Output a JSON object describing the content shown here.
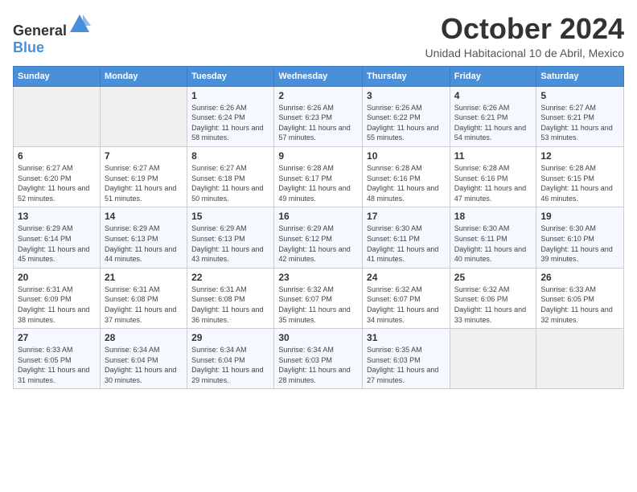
{
  "header": {
    "logo_general": "General",
    "logo_blue": "Blue",
    "month": "October 2024",
    "location": "Unidad Habitacional 10 de Abril, Mexico"
  },
  "days_of_week": [
    "Sunday",
    "Monday",
    "Tuesday",
    "Wednesday",
    "Thursday",
    "Friday",
    "Saturday"
  ],
  "weeks": [
    [
      {
        "day": "",
        "info": ""
      },
      {
        "day": "",
        "info": ""
      },
      {
        "day": "1",
        "info": "Sunrise: 6:26 AM\nSunset: 6:24 PM\nDaylight: 11 hours and 58 minutes."
      },
      {
        "day": "2",
        "info": "Sunrise: 6:26 AM\nSunset: 6:23 PM\nDaylight: 11 hours and 57 minutes."
      },
      {
        "day": "3",
        "info": "Sunrise: 6:26 AM\nSunset: 6:22 PM\nDaylight: 11 hours and 55 minutes."
      },
      {
        "day": "4",
        "info": "Sunrise: 6:26 AM\nSunset: 6:21 PM\nDaylight: 11 hours and 54 minutes."
      },
      {
        "day": "5",
        "info": "Sunrise: 6:27 AM\nSunset: 6:21 PM\nDaylight: 11 hours and 53 minutes."
      }
    ],
    [
      {
        "day": "6",
        "info": "Sunrise: 6:27 AM\nSunset: 6:20 PM\nDaylight: 11 hours and 52 minutes."
      },
      {
        "day": "7",
        "info": "Sunrise: 6:27 AM\nSunset: 6:19 PM\nDaylight: 11 hours and 51 minutes."
      },
      {
        "day": "8",
        "info": "Sunrise: 6:27 AM\nSunset: 6:18 PM\nDaylight: 11 hours and 50 minutes."
      },
      {
        "day": "9",
        "info": "Sunrise: 6:28 AM\nSunset: 6:17 PM\nDaylight: 11 hours and 49 minutes."
      },
      {
        "day": "10",
        "info": "Sunrise: 6:28 AM\nSunset: 6:16 PM\nDaylight: 11 hours and 48 minutes."
      },
      {
        "day": "11",
        "info": "Sunrise: 6:28 AM\nSunset: 6:16 PM\nDaylight: 11 hours and 47 minutes."
      },
      {
        "day": "12",
        "info": "Sunrise: 6:28 AM\nSunset: 6:15 PM\nDaylight: 11 hours and 46 minutes."
      }
    ],
    [
      {
        "day": "13",
        "info": "Sunrise: 6:29 AM\nSunset: 6:14 PM\nDaylight: 11 hours and 45 minutes."
      },
      {
        "day": "14",
        "info": "Sunrise: 6:29 AM\nSunset: 6:13 PM\nDaylight: 11 hours and 44 minutes."
      },
      {
        "day": "15",
        "info": "Sunrise: 6:29 AM\nSunset: 6:13 PM\nDaylight: 11 hours and 43 minutes."
      },
      {
        "day": "16",
        "info": "Sunrise: 6:29 AM\nSunset: 6:12 PM\nDaylight: 11 hours and 42 minutes."
      },
      {
        "day": "17",
        "info": "Sunrise: 6:30 AM\nSunset: 6:11 PM\nDaylight: 11 hours and 41 minutes."
      },
      {
        "day": "18",
        "info": "Sunrise: 6:30 AM\nSunset: 6:11 PM\nDaylight: 11 hours and 40 minutes."
      },
      {
        "day": "19",
        "info": "Sunrise: 6:30 AM\nSunset: 6:10 PM\nDaylight: 11 hours and 39 minutes."
      }
    ],
    [
      {
        "day": "20",
        "info": "Sunrise: 6:31 AM\nSunset: 6:09 PM\nDaylight: 11 hours and 38 minutes."
      },
      {
        "day": "21",
        "info": "Sunrise: 6:31 AM\nSunset: 6:08 PM\nDaylight: 11 hours and 37 minutes."
      },
      {
        "day": "22",
        "info": "Sunrise: 6:31 AM\nSunset: 6:08 PM\nDaylight: 11 hours and 36 minutes."
      },
      {
        "day": "23",
        "info": "Sunrise: 6:32 AM\nSunset: 6:07 PM\nDaylight: 11 hours and 35 minutes."
      },
      {
        "day": "24",
        "info": "Sunrise: 6:32 AM\nSunset: 6:07 PM\nDaylight: 11 hours and 34 minutes."
      },
      {
        "day": "25",
        "info": "Sunrise: 6:32 AM\nSunset: 6:06 PM\nDaylight: 11 hours and 33 minutes."
      },
      {
        "day": "26",
        "info": "Sunrise: 6:33 AM\nSunset: 6:05 PM\nDaylight: 11 hours and 32 minutes."
      }
    ],
    [
      {
        "day": "27",
        "info": "Sunrise: 6:33 AM\nSunset: 6:05 PM\nDaylight: 11 hours and 31 minutes."
      },
      {
        "day": "28",
        "info": "Sunrise: 6:34 AM\nSunset: 6:04 PM\nDaylight: 11 hours and 30 minutes."
      },
      {
        "day": "29",
        "info": "Sunrise: 6:34 AM\nSunset: 6:04 PM\nDaylight: 11 hours and 29 minutes."
      },
      {
        "day": "30",
        "info": "Sunrise: 6:34 AM\nSunset: 6:03 PM\nDaylight: 11 hours and 28 minutes."
      },
      {
        "day": "31",
        "info": "Sunrise: 6:35 AM\nSunset: 6:03 PM\nDaylight: 11 hours and 27 minutes."
      },
      {
        "day": "",
        "info": ""
      },
      {
        "day": "",
        "info": ""
      }
    ]
  ]
}
